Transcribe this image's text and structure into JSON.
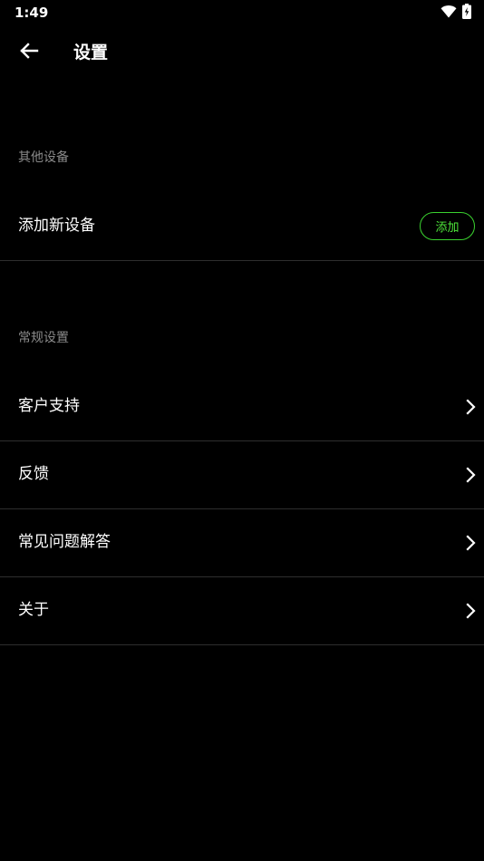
{
  "status_bar": {
    "time": "1:49"
  },
  "app_bar": {
    "title": "设置"
  },
  "sections": {
    "other_devices": {
      "header": "其他设备",
      "add_device": {
        "label": "添加新设备",
        "button_label": "添加"
      }
    },
    "general": {
      "header": "常规设置",
      "items": [
        {
          "label": "客户支持"
        },
        {
          "label": "反馈"
        },
        {
          "label": "常见问题解答"
        },
        {
          "label": "关于"
        }
      ]
    }
  },
  "colors": {
    "background": "#000000",
    "text": "#ffffff",
    "section_header": "#8a8a8a",
    "accent_green": "#3ad12f",
    "divider": "#2e2e2e"
  },
  "icons": {
    "back": "arrow-left-icon",
    "chevron": "chevron-right-icon",
    "wifi": "wifi-icon",
    "battery": "battery-charging-icon"
  }
}
